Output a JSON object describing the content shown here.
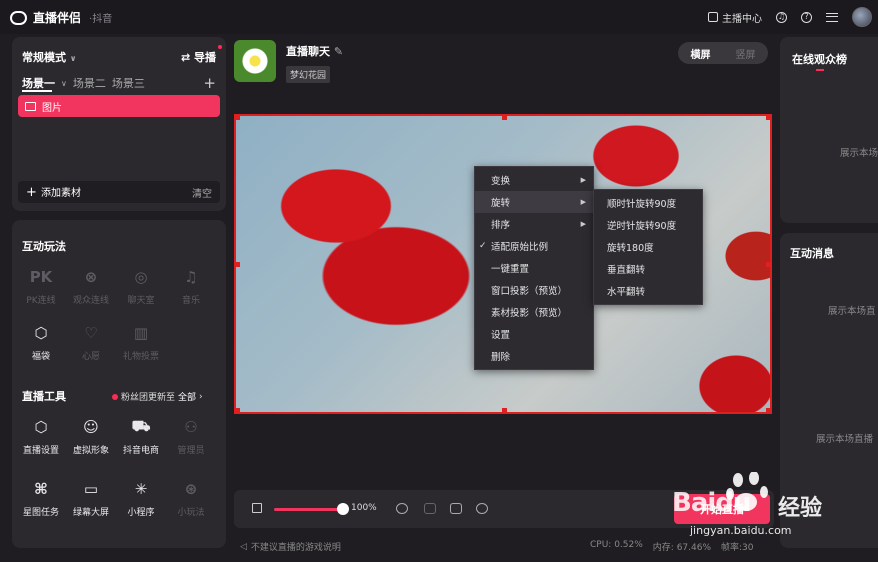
{
  "app": {
    "name": "直播伴侣",
    "platform": "抖音"
  },
  "topbar": {
    "creator_center": "主播中心"
  },
  "left_panel": {
    "mode": "常规模式",
    "guide": "导播",
    "scenes": [
      "场景一",
      "场景二",
      "场景三"
    ],
    "material_item": "图片",
    "add_material": "添加素材",
    "clear": "清空"
  },
  "interactive": {
    "title": "互动玩法",
    "items": [
      {
        "label": "PK连线",
        "glyph": "PK",
        "icon": "pk-icon",
        "enabled": false
      },
      {
        "label": "观众连线",
        "glyph": "⊗",
        "icon": "audience-link-icon",
        "enabled": false
      },
      {
        "label": "聊天室",
        "glyph": "◎",
        "icon": "chatroom-icon",
        "enabled": false
      },
      {
        "label": "音乐",
        "glyph": "♫",
        "icon": "music-icon",
        "enabled": false
      },
      {
        "label": "福袋",
        "glyph": "⬡",
        "icon": "lucky-bag-icon",
        "enabled": true
      },
      {
        "label": "心愿",
        "glyph": "♡",
        "icon": "wish-icon",
        "enabled": false
      },
      {
        "label": "礼物投票",
        "glyph": "▥",
        "icon": "gift-vote-icon",
        "enabled": false
      }
    ]
  },
  "tools": {
    "title": "直播工具",
    "fans_notice": "粉丝团更新至",
    "all_link": "全部",
    "items": [
      {
        "label": "直播设置",
        "glyph": "⬡",
        "icon": "live-settings-icon",
        "enabled": true
      },
      {
        "label": "虚拟形象",
        "glyph": "☺",
        "icon": "avatar-icon",
        "enabled": true
      },
      {
        "label": "抖音电商",
        "glyph": "⛟",
        "icon": "cart-icon",
        "enabled": true
      },
      {
        "label": "管理员",
        "glyph": "⚇",
        "icon": "admin-icon",
        "enabled": false
      },
      {
        "label": "星图任务",
        "glyph": "⌘",
        "icon": "star-task-icon",
        "enabled": true
      },
      {
        "label": "绿幕大屏",
        "glyph": "▭",
        "icon": "green-screen-icon",
        "enabled": true
      },
      {
        "label": "小程序",
        "glyph": "✳",
        "icon": "mini-program-icon",
        "enabled": true
      },
      {
        "label": "小玩法",
        "glyph": "⊛",
        "icon": "mini-game-icon",
        "enabled": false
      }
    ]
  },
  "stream": {
    "title": "直播聊天",
    "tag": "梦幻花园",
    "orientation": {
      "landscape": "横屏",
      "portrait": "竖屏"
    }
  },
  "context_menu": {
    "items": [
      {
        "label": "变换",
        "submenu": true
      },
      {
        "label": "旋转",
        "submenu": true,
        "highlight": true
      },
      {
        "label": "排序",
        "submenu": true
      },
      {
        "label": "适配原始比例",
        "checked": true
      },
      {
        "label": "一键重置"
      },
      {
        "label": "窗口投影（预览）"
      },
      {
        "label": "素材投影（预览）"
      },
      {
        "label": "设置"
      },
      {
        "label": "删除"
      }
    ],
    "rotate_submenu": [
      "顺时针旋转90度",
      "逆时针旋转90度",
      "旋转180度",
      "垂直翻转",
      "水平翻转"
    ]
  },
  "controls": {
    "volume_percent": 100,
    "volume_label": "100%",
    "start_button": "开始直播"
  },
  "status": {
    "hint": "不建议直播的游戏说明",
    "cpu": "CPU: 0.52%",
    "memory": "内存: 67.46%",
    "fps": "帧率:30"
  },
  "right_panel": {
    "audience_title": "在线观众榜",
    "audience_empty": "展示本场",
    "messages_title": "互动消息",
    "messages_empty": "展示本场直",
    "messages_empty2": "展示本场直播"
  },
  "watermark": {
    "brand": "Baidu",
    "cn": "经验",
    "url": "jingyan.baidu.com"
  },
  "colors": {
    "accent": "#f2355e",
    "selection": "#e02020",
    "bg": "#1f1d21",
    "panel": "#2b292e"
  }
}
